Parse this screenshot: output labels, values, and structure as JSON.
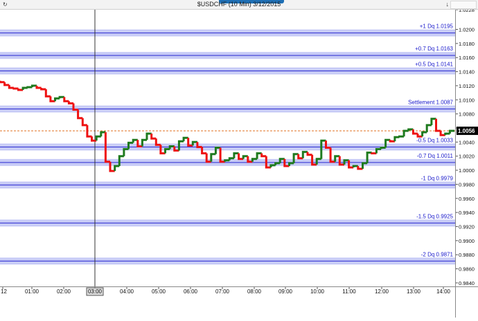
{
  "window": {
    "title": "$USDCHF (10 Min)  3/12/2015",
    "left_label": "↻",
    "right_label": "↓"
  },
  "chart_data": {
    "type": "line",
    "symbol": "$USDCHF",
    "interval": "10 Min",
    "date": "3/12/2015",
    "ylim": [
      0.9835,
      1.0228
    ],
    "y_ticks": [
      "1.0228",
      "1.0200",
      "1.0180",
      "1.0160",
      "1.0140",
      "1.0120",
      "1.0100",
      "1.0080",
      "1.0060",
      "1.0040",
      "1.0020",
      "1.0000",
      "0.9980",
      "0.9960",
      "0.9940",
      "0.9920",
      "0.9900",
      "0.9880",
      "0.9860",
      "0.9840"
    ],
    "x_ticks": [
      "12",
      "01:00",
      "02:00",
      "03:00",
      "04:00",
      "05:00",
      "06:00",
      "07:00",
      "08:00",
      "09:00",
      "10:00",
      "11:00",
      "12:00",
      "13:00",
      "14:00"
    ],
    "current_price": "1.0056",
    "cursor_time": "03:00",
    "levels": [
      {
        "label": "+1 Dq 1.0195",
        "value": 1.0195
      },
      {
        "label": "+0.7 Dq 1.0163",
        "value": 1.0163
      },
      {
        "label": "+0.5 Dq 1.0141",
        "value": 1.0141
      },
      {
        "label": "Settlement 1.0087",
        "value": 1.0087
      },
      {
        "label": "-0.5 Dq 1.0033",
        "value": 1.0033
      },
      {
        "label": "-0.7 Dq 1.0011",
        "value": 1.0011
      },
      {
        "label": "-1 Dq 0.9979",
        "value": 0.9979
      },
      {
        "label": "-1.5 Dq 0.9925",
        "value": 0.9925
      },
      {
        "label": "-2 Dq 0.9871",
        "value": 0.9871
      }
    ],
    "closes": [
      1.0125,
      1.0121,
      1.0117,
      1.0116,
      1.0114,
      1.0117,
      1.0118,
      1.012,
      1.0117,
      1.0115,
      1.0105,
      1.0098,
      1.0102,
      1.0104,
      1.0098,
      1.0095,
      1.0086,
      1.0074,
      1.0064,
      1.0048,
      1.0042,
      1.0048,
      1.0054,
      1.0012,
      0.9999,
      1.0006,
      1.002,
      1.003,
      1.0039,
      1.0043,
      1.0034,
      1.0043,
      1.0052,
      1.0045,
      1.0036,
      1.0024,
      1.003,
      1.0034,
      1.0028,
      1.0041,
      1.0046,
      1.0035,
      1.004,
      1.0033,
      1.0024,
      1.0012,
      1.0023,
      1.0032,
      1.0012,
      1.0014,
      1.0017,
      1.0024,
      1.0016,
      1.002,
      1.0012,
      1.0016,
      1.0024,
      1.002,
      1.0004,
      1.0007,
      1.001,
      1.0016,
      1.0006,
      1.001,
      1.0023,
      1.0017,
      1.0026,
      1.0022,
      1.0008,
      1.0016,
      1.0042,
      1.0032,
      1.0012,
      1.002,
      1.0008,
      1.0014,
      1.0004,
      1.0006,
      1.0002,
      1.001,
      1.0025,
      1.0024,
      1.003,
      1.0032,
      1.0043,
      1.0041,
      1.0047,
      1.0048,
      1.0056,
      1.0058,
      1.0052,
      1.0048,
      1.0054,
      1.0064,
      1.0073,
      1.0056,
      1.005,
      1.0052,
      1.0056
    ]
  },
  "colors": {
    "up_bar": "#1e7a1e",
    "down_bar": "#ee1111",
    "band": "#c7cbf6",
    "band_line": "#2a2ad0",
    "level_text": "#1a1acc",
    "price_line": "#e07020",
    "background": "#ffffff"
  }
}
